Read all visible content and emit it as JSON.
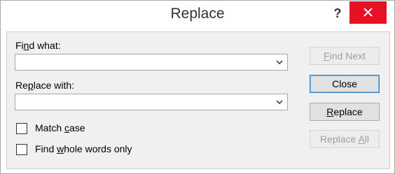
{
  "window": {
    "title": "Replace",
    "help_label": "?"
  },
  "find": {
    "label_pre": "Fi",
    "label_key": "n",
    "label_post": "d what:",
    "value": ""
  },
  "replace": {
    "label_pre": "Re",
    "label_key": "p",
    "label_post": "lace with:",
    "value": ""
  },
  "options": {
    "match_case": {
      "pre": "Match ",
      "key": "c",
      "post": "ase",
      "checked": false
    },
    "whole_words": {
      "pre": "Find ",
      "key": "w",
      "post": "hole words only",
      "checked": false
    }
  },
  "buttons": {
    "find_next": {
      "pre": "",
      "key": "F",
      "post": "ind Next",
      "enabled": false
    },
    "close": {
      "pre": "Close",
      "key": "",
      "post": "",
      "enabled": true
    },
    "replace": {
      "pre": "",
      "key": "R",
      "post": "eplace",
      "enabled": true
    },
    "replace_all": {
      "pre": "Replace ",
      "key": "A",
      "post": "ll",
      "enabled": false
    }
  },
  "colors": {
    "close_red": "#e81123",
    "disabled_text": "#a0a0a0",
    "dialog_bg": "#f0f0f0"
  }
}
